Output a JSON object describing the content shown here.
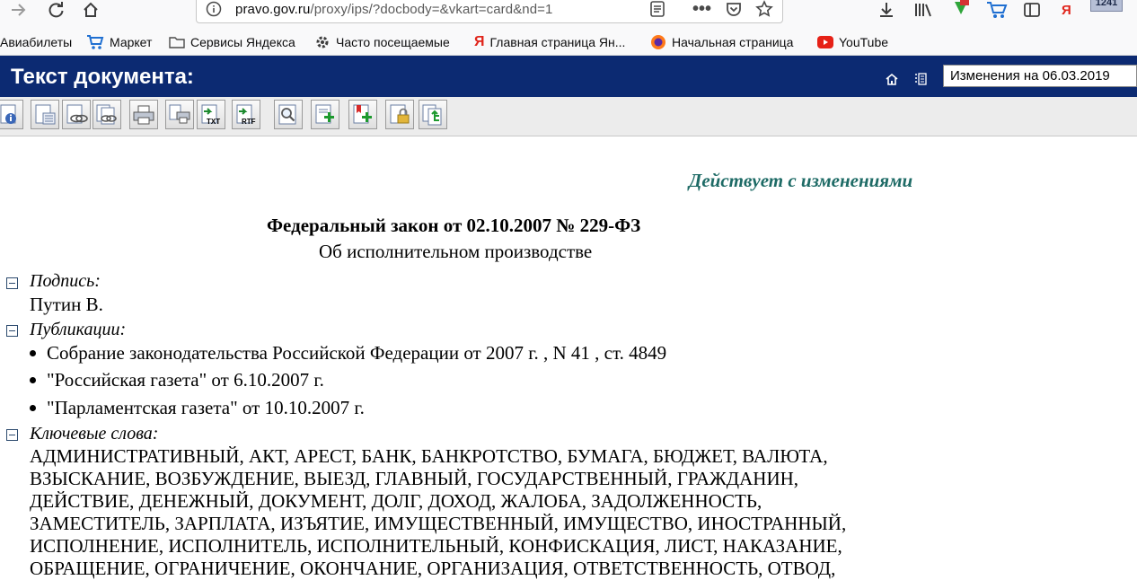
{
  "browser": {
    "url_host": "pravo.gov.ru",
    "url_path": "/proxy/ips/?docbody=&vkart=card&nd=1",
    "badge_count": "1241",
    "yandex_letter": "Я"
  },
  "bookmarks": [
    {
      "label": "Авиабилеты",
      "icon": "none"
    },
    {
      "label": "Маркет",
      "icon": "cart-icon"
    },
    {
      "label": "Сервисы Яндекса",
      "icon": "folder-icon"
    },
    {
      "label": "Часто посещаемые",
      "icon": "gear-icon"
    },
    {
      "label": "Главная страница Ян...",
      "icon": "yandex-icon"
    },
    {
      "label": "Начальная страница",
      "icon": "firefox-icon"
    },
    {
      "label": "YouTube",
      "icon": "youtube-icon"
    }
  ],
  "header": {
    "title": "Текст документа:",
    "select_value": "Изменения на 06.03.2019"
  },
  "document": {
    "status": "Действует с изменениями",
    "law_title": "Федеральный закон от 02.10.2007 № 229-ФЗ",
    "law_subtitle": "Об исполнительном производстве",
    "signature_label": "Подпись:",
    "signature_value": "Путин В.",
    "publications_label": "Публикации:",
    "publications": [
      "Собрание законодательства Российской Федерации от 2007 г. , N 41 , ст. 4849",
      "\"Российская газета\" от 6.10.2007 г.",
      "\"Парламентская газета\" от 10.10.2007 г."
    ],
    "keywords_label": "Ключевые слова:",
    "keyword_lines": [
      "АДМИНИСТРАТИВНЫЙ, АКТ, АРЕСТ, БАНК, БАНКРОТСТВО, БУМАГА, БЮДЖЕТ, ВАЛЮТА,",
      "ВЗЫСКАНИЕ, ВОЗБУЖДЕНИЕ, ВЫЕЗД, ГЛАВНЫЙ, ГОСУДАРСТВЕННЫЙ, ГРАЖДАНИН,",
      "ДЕЙСТВИЕ, ДЕНЕЖНЫЙ, ДОКУМЕНТ, ДОЛГ, ДОХОД, ЖАЛОБА, ЗАДОЛЖЕННОСТЬ,",
      "ЗАМЕСТИТЕЛЬ, ЗАРПЛАТА, ИЗЪЯТИЕ, ИМУЩЕСТВЕННЫЙ, ИМУЩЕСТВО, ИНОСТРАННЫЙ,",
      "ИСПОЛНЕНИЕ, ИСПОЛНИТЕЛЬ, ИСПОЛНИТЕЛЬНЫЙ, КОНФИСКАЦИЯ, ЛИСТ, НАКАЗАНИЕ,",
      "ОБРАЩЕНИЕ, ОГРАНИЧЕНИЕ, ОКОНЧАНИЕ, ОРГАНИЗАЦИЯ, ОТВЕТСТВЕННОСТЬ, ОТВОД,"
    ]
  },
  "colors": {
    "header_bg": "#0c2a72",
    "status_text": "#1e6b66"
  }
}
